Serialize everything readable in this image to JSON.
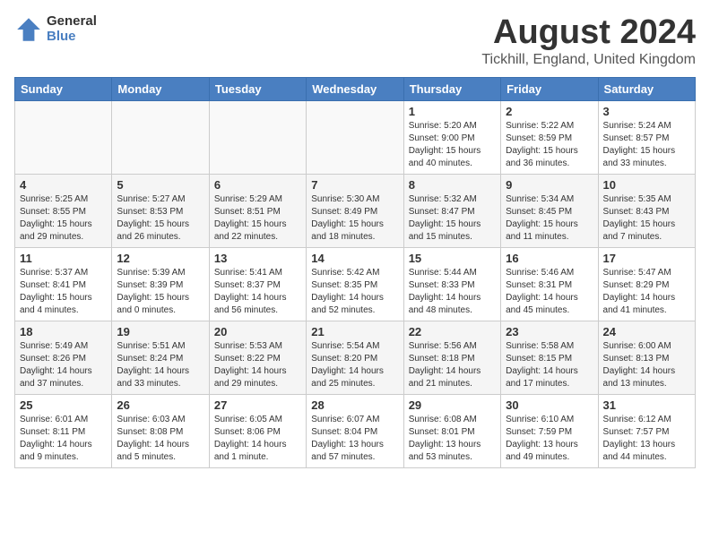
{
  "header": {
    "logo": {
      "general": "General",
      "blue": "Blue"
    },
    "month": "August 2024",
    "location": "Tickhill, England, United Kingdom"
  },
  "weekdays": [
    "Sunday",
    "Monday",
    "Tuesday",
    "Wednesday",
    "Thursday",
    "Friday",
    "Saturday"
  ],
  "weeks": [
    [
      {
        "day": "",
        "info": ""
      },
      {
        "day": "",
        "info": ""
      },
      {
        "day": "",
        "info": ""
      },
      {
        "day": "",
        "info": ""
      },
      {
        "day": "1",
        "info": "Sunrise: 5:20 AM\nSunset: 9:00 PM\nDaylight: 15 hours\nand 40 minutes."
      },
      {
        "day": "2",
        "info": "Sunrise: 5:22 AM\nSunset: 8:59 PM\nDaylight: 15 hours\nand 36 minutes."
      },
      {
        "day": "3",
        "info": "Sunrise: 5:24 AM\nSunset: 8:57 PM\nDaylight: 15 hours\nand 33 minutes."
      }
    ],
    [
      {
        "day": "4",
        "info": "Sunrise: 5:25 AM\nSunset: 8:55 PM\nDaylight: 15 hours\nand 29 minutes."
      },
      {
        "day": "5",
        "info": "Sunrise: 5:27 AM\nSunset: 8:53 PM\nDaylight: 15 hours\nand 26 minutes."
      },
      {
        "day": "6",
        "info": "Sunrise: 5:29 AM\nSunset: 8:51 PM\nDaylight: 15 hours\nand 22 minutes."
      },
      {
        "day": "7",
        "info": "Sunrise: 5:30 AM\nSunset: 8:49 PM\nDaylight: 15 hours\nand 18 minutes."
      },
      {
        "day": "8",
        "info": "Sunrise: 5:32 AM\nSunset: 8:47 PM\nDaylight: 15 hours\nand 15 minutes."
      },
      {
        "day": "9",
        "info": "Sunrise: 5:34 AM\nSunset: 8:45 PM\nDaylight: 15 hours\nand 11 minutes."
      },
      {
        "day": "10",
        "info": "Sunrise: 5:35 AM\nSunset: 8:43 PM\nDaylight: 15 hours\nand 7 minutes."
      }
    ],
    [
      {
        "day": "11",
        "info": "Sunrise: 5:37 AM\nSunset: 8:41 PM\nDaylight: 15 hours\nand 4 minutes."
      },
      {
        "day": "12",
        "info": "Sunrise: 5:39 AM\nSunset: 8:39 PM\nDaylight: 15 hours\nand 0 minutes."
      },
      {
        "day": "13",
        "info": "Sunrise: 5:41 AM\nSunset: 8:37 PM\nDaylight: 14 hours\nand 56 minutes."
      },
      {
        "day": "14",
        "info": "Sunrise: 5:42 AM\nSunset: 8:35 PM\nDaylight: 14 hours\nand 52 minutes."
      },
      {
        "day": "15",
        "info": "Sunrise: 5:44 AM\nSunset: 8:33 PM\nDaylight: 14 hours\nand 48 minutes."
      },
      {
        "day": "16",
        "info": "Sunrise: 5:46 AM\nSunset: 8:31 PM\nDaylight: 14 hours\nand 45 minutes."
      },
      {
        "day": "17",
        "info": "Sunrise: 5:47 AM\nSunset: 8:29 PM\nDaylight: 14 hours\nand 41 minutes."
      }
    ],
    [
      {
        "day": "18",
        "info": "Sunrise: 5:49 AM\nSunset: 8:26 PM\nDaylight: 14 hours\nand 37 minutes."
      },
      {
        "day": "19",
        "info": "Sunrise: 5:51 AM\nSunset: 8:24 PM\nDaylight: 14 hours\nand 33 minutes."
      },
      {
        "day": "20",
        "info": "Sunrise: 5:53 AM\nSunset: 8:22 PM\nDaylight: 14 hours\nand 29 minutes."
      },
      {
        "day": "21",
        "info": "Sunrise: 5:54 AM\nSunset: 8:20 PM\nDaylight: 14 hours\nand 25 minutes."
      },
      {
        "day": "22",
        "info": "Sunrise: 5:56 AM\nSunset: 8:18 PM\nDaylight: 14 hours\nand 21 minutes."
      },
      {
        "day": "23",
        "info": "Sunrise: 5:58 AM\nSunset: 8:15 PM\nDaylight: 14 hours\nand 17 minutes."
      },
      {
        "day": "24",
        "info": "Sunrise: 6:00 AM\nSunset: 8:13 PM\nDaylight: 14 hours\nand 13 minutes."
      }
    ],
    [
      {
        "day": "25",
        "info": "Sunrise: 6:01 AM\nSunset: 8:11 PM\nDaylight: 14 hours\nand 9 minutes."
      },
      {
        "day": "26",
        "info": "Sunrise: 6:03 AM\nSunset: 8:08 PM\nDaylight: 14 hours\nand 5 minutes."
      },
      {
        "day": "27",
        "info": "Sunrise: 6:05 AM\nSunset: 8:06 PM\nDaylight: 14 hours\nand 1 minute."
      },
      {
        "day": "28",
        "info": "Sunrise: 6:07 AM\nSunset: 8:04 PM\nDaylight: 13 hours\nand 57 minutes."
      },
      {
        "day": "29",
        "info": "Sunrise: 6:08 AM\nSunset: 8:01 PM\nDaylight: 13 hours\nand 53 minutes."
      },
      {
        "day": "30",
        "info": "Sunrise: 6:10 AM\nSunset: 7:59 PM\nDaylight: 13 hours\nand 49 minutes."
      },
      {
        "day": "31",
        "info": "Sunrise: 6:12 AM\nSunset: 7:57 PM\nDaylight: 13 hours\nand 44 minutes."
      }
    ]
  ]
}
